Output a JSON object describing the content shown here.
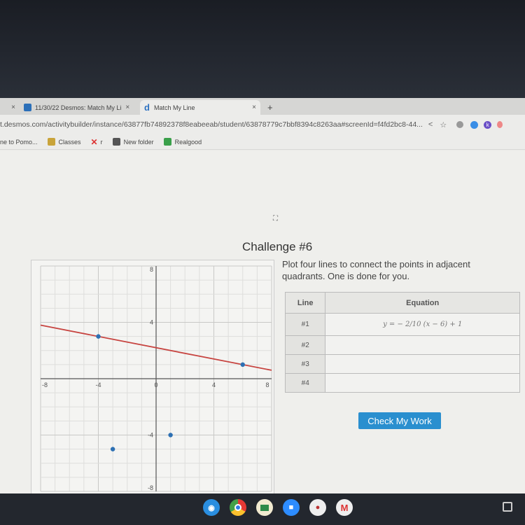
{
  "browser": {
    "tabs": [
      {
        "label": "",
        "close": "×"
      },
      {
        "label": "11/30/22 Desmos: Match My Li",
        "close": "×"
      },
      {
        "label": "Match My Line",
        "close": "×",
        "active": true
      }
    ],
    "new_tab": "+",
    "url": "t.desmos.com/activitybuilder/instance/63877fb74892378f8eabeeab/student/63878779c7bbf8394c8263aa#screenId=f4fd2bc8-44...",
    "bookmarks": [
      {
        "label": "ne to Pomo..."
      },
      {
        "label": "Classes"
      },
      {
        "label": "r"
      },
      {
        "label": "New folder"
      },
      {
        "label": "Realgood"
      }
    ]
  },
  "activity": {
    "title": "Challenge #6",
    "prompt": "Plot four lines to connect the points in adjacent quadrants. One is done for you.",
    "table": {
      "headers": [
        "Line",
        "Equation"
      ],
      "rows": [
        {
          "line": "#1",
          "equation": "y = − 2/10 (x − 6) + 1"
        },
        {
          "line": "#2",
          "equation": ""
        },
        {
          "line": "#3",
          "equation": ""
        },
        {
          "line": "#4",
          "equation": ""
        }
      ]
    },
    "check_button": "Check My Work"
  },
  "chart_data": {
    "type": "scatter",
    "xlim": [
      -8,
      8
    ],
    "ylim": [
      -8,
      8
    ],
    "x_ticks": [
      -8,
      -4,
      0,
      4,
      8
    ],
    "y_ticks": [
      8,
      4,
      -4,
      -8
    ],
    "x_tick_labels": [
      "-8",
      "-4",
      "0",
      "4",
      "8"
    ],
    "y_tick_labels": [
      "8",
      "4",
      "-4",
      "-8"
    ],
    "grid": true,
    "points": [
      {
        "x": -4,
        "y": 3
      },
      {
        "x": 6,
        "y": 1
      },
      {
        "x": 1,
        "y": -4
      },
      {
        "x": -3,
        "y": -5
      }
    ],
    "lines": [
      {
        "slope": -0.2,
        "x0": 6,
        "y0": 1,
        "color": "#c74440"
      }
    ],
    "point_color": "#2d70b3"
  }
}
